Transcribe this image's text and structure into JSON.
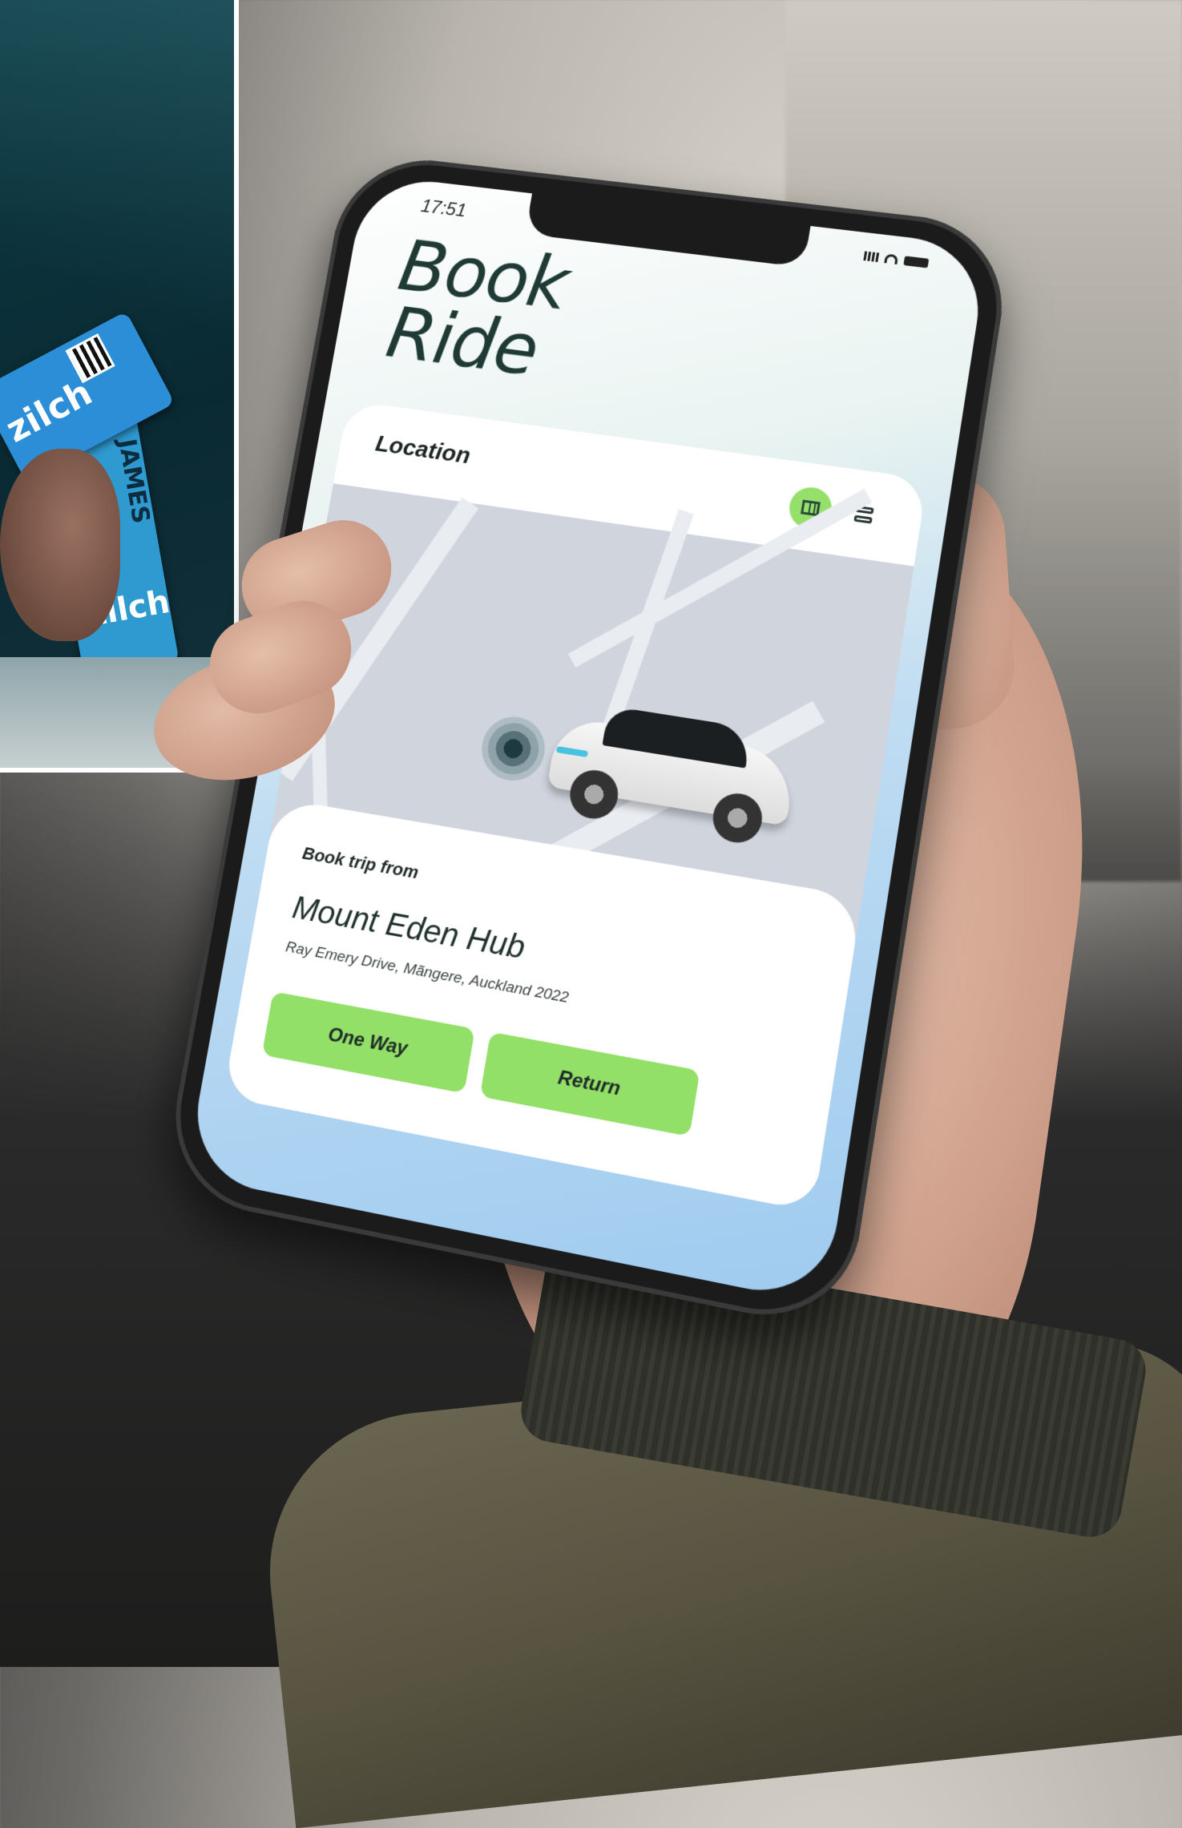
{
  "inset_photo": {
    "card_brand": "zilch",
    "card_name": "JAMES"
  },
  "status_bar": {
    "time": "17:51"
  },
  "screen": {
    "title_line1": "Book",
    "title_line2": "Ride",
    "location_label": "Location",
    "view_toggle": {
      "map_icon": "map-icon",
      "list_icon": "list-icon",
      "active": "map"
    },
    "trip": {
      "label": "Book trip from",
      "hub_name": "Mount Eden Hub",
      "hub_address": "Ray Emery Drive, Mãngere, Auckland 2022"
    },
    "buttons": {
      "one_way": "One Way",
      "return": "Return"
    }
  },
  "colors": {
    "accent_green": "#92e067",
    "title_color": "#1f3a34"
  }
}
